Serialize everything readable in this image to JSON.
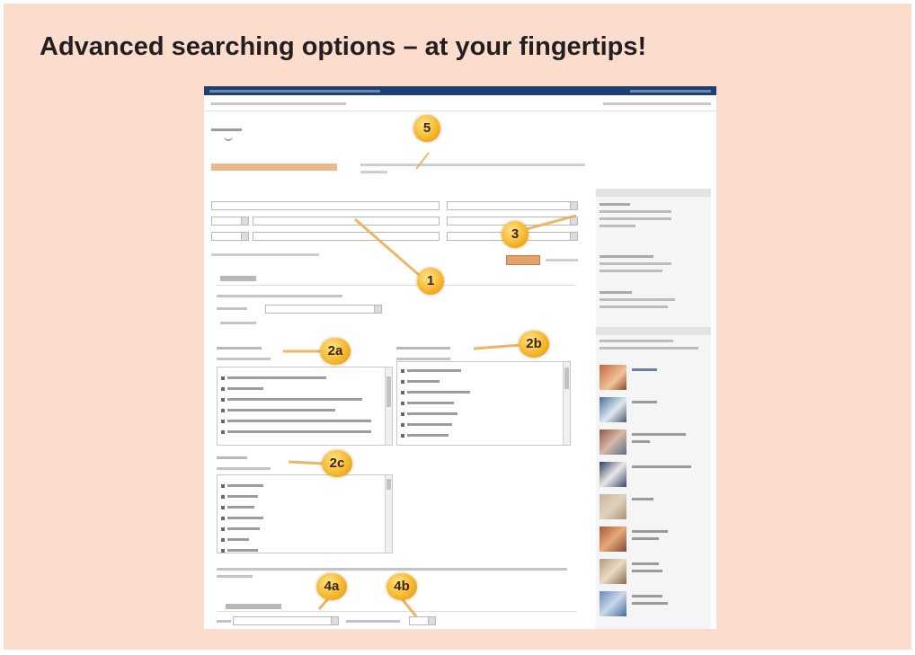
{
  "slide": {
    "title": "Advanced searching options – at your fingertips!"
  },
  "colors": {
    "panel_bg": "#fcdccd",
    "topbar": "#1d3f71",
    "accent": "#e4a16a",
    "badge": "#f5b82e"
  },
  "badges": {
    "b1": "1",
    "b2a": "2a",
    "b2b": "2b",
    "b2c": "2c",
    "b3": "3",
    "b4a": "4a",
    "b4b": "4b",
    "b5": "5"
  }
}
